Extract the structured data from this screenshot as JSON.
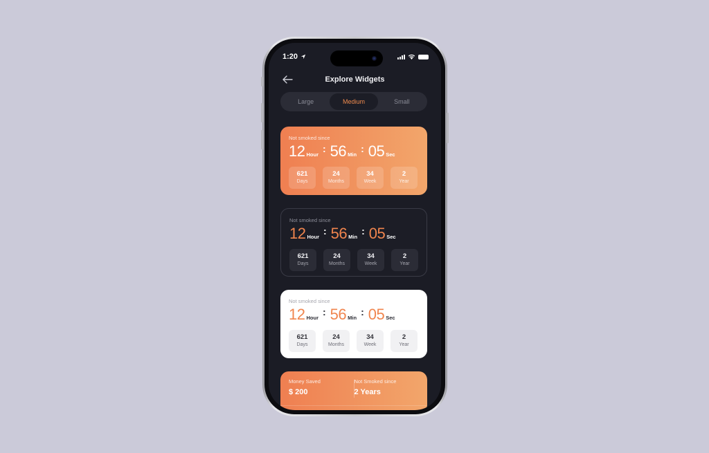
{
  "status_bar": {
    "time": "1:20",
    "icons": [
      "location-arrow-icon",
      "cellular-signal-icon",
      "wifi-icon",
      "battery-icon"
    ]
  },
  "nav": {
    "back_icon": "arrow-left-icon",
    "title": "Explore Widgets"
  },
  "segmented": {
    "items": [
      {
        "label": "Large",
        "active": false
      },
      {
        "label": "Medium",
        "active": true
      },
      {
        "label": "Small",
        "active": false
      }
    ]
  },
  "widgets": [
    {
      "variant": "orange",
      "caption": "Not smoked since",
      "timer": {
        "hours": "12",
        "hours_unit": "Hour",
        "minutes": "56",
        "minutes_unit": "Min",
        "seconds": "05",
        "seconds_unit": "Sec",
        "separator": ":"
      },
      "stats": [
        {
          "value": "621",
          "label": "Days"
        },
        {
          "value": "24",
          "label": "Months"
        },
        {
          "value": "34",
          "label": "Week"
        },
        {
          "value": "2",
          "label": "Year"
        }
      ]
    },
    {
      "variant": "dark",
      "caption": "Not smoked since",
      "timer": {
        "hours": "12",
        "hours_unit": "Hour",
        "minutes": "56",
        "minutes_unit": "Min",
        "seconds": "05",
        "seconds_unit": "Sec",
        "separator": ":"
      },
      "stats": [
        {
          "value": "621",
          "label": "Days"
        },
        {
          "value": "24",
          "label": "Months"
        },
        {
          "value": "34",
          "label": "Week"
        },
        {
          "value": "2",
          "label": "Year"
        }
      ]
    },
    {
      "variant": "light",
      "caption": "Not smoked since",
      "timer": {
        "hours": "12",
        "hours_unit": "Hour",
        "minutes": "56",
        "minutes_unit": "Min",
        "seconds": "05",
        "seconds_unit": "Sec",
        "separator": ":"
      },
      "stats": [
        {
          "value": "621",
          "label": "Days"
        },
        {
          "value": "24",
          "label": "Months"
        },
        {
          "value": "34",
          "label": "Week"
        },
        {
          "value": "2",
          "label": "Year"
        }
      ]
    }
  ],
  "summary": {
    "money_label": "Money Saved",
    "money_value": "$ 200",
    "since_label": "Not Smoked since",
    "since_value": "2 Years"
  },
  "colors": {
    "accent": "#f0854e",
    "gradient_start": "#ef7f51",
    "gradient_end": "#f2a66b",
    "screen_bg": "#1b1c25",
    "page_bg": "#cbcad9"
  }
}
